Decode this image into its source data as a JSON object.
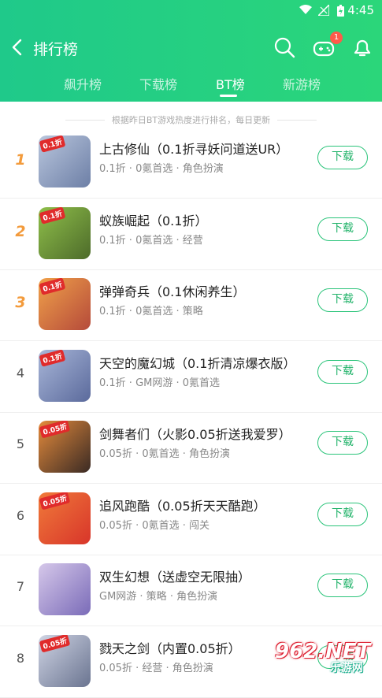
{
  "status_bar": {
    "time": "4:45"
  },
  "header": {
    "title": "排行榜",
    "notification_count": "1"
  },
  "tabs": [
    {
      "label": "飙升榜",
      "active": false
    },
    {
      "label": "下载榜",
      "active": false
    },
    {
      "label": "BT榜",
      "active": true
    },
    {
      "label": "新游榜",
      "active": false
    }
  ],
  "notice": "根据昨日BT游戏热度进行排名，每日更新",
  "download_label": "下载",
  "games": [
    {
      "rank": "1",
      "name": "上古修仙（0.1折寻妖问道送UR）",
      "meta": "0.1折 · 0氪首选 · 角色扮演",
      "tag": "0.1折",
      "colors": [
        "#b9c6dd",
        "#6d7fa6"
      ]
    },
    {
      "rank": "2",
      "name": "蚁族崛起（0.1折）",
      "meta": "0.1折 · 0氪首选 · 经营",
      "tag": "0.1折",
      "colors": [
        "#8fbf4a",
        "#4d6b2a"
      ]
    },
    {
      "rank": "3",
      "name": "弹弹奇兵（0.1休闲养生）",
      "meta": "0.1折 · 0氪首选 · 策略",
      "tag": "0.1折",
      "colors": [
        "#f0a14a",
        "#b54a3a"
      ]
    },
    {
      "rank": "4",
      "name": "天空的魔幻城（0.1折清凉爆衣版）",
      "meta": "0.1折 · GM网游 · 0氪首选",
      "tag": "0.1折",
      "colors": [
        "#a8b6d8",
        "#5b6a9c"
      ]
    },
    {
      "rank": "5",
      "name": "剑舞者们（火影0.05折送我爱罗）",
      "meta": "0.05折 · 0氪首选 · 角色扮演",
      "tag": "0.05折",
      "colors": [
        "#e48b3c",
        "#3a2a24"
      ]
    },
    {
      "rank": "6",
      "name": "追风跑酷（0.05折天天酷跑）",
      "meta": "0.05折 · 0氪首选 · 闯关",
      "tag": "0.05折",
      "colors": [
        "#f07a3a",
        "#d8352a"
      ]
    },
    {
      "rank": "7",
      "name": "双生幻想（送虚空无限抽）",
      "meta": "GM网游 · 策略 · 角色扮演",
      "tag": "",
      "colors": [
        "#d6c8ea",
        "#7a6bb8"
      ]
    },
    {
      "rank": "8",
      "name": "戮天之剑（内置0.05折）",
      "meta": "0.05折 · 经营 · 角色扮演",
      "tag": "0.05折",
      "colors": [
        "#cfd4e4",
        "#6a7490"
      ]
    }
  ],
  "watermark": {
    "line1": "962.NET",
    "line2": "乐游网"
  }
}
